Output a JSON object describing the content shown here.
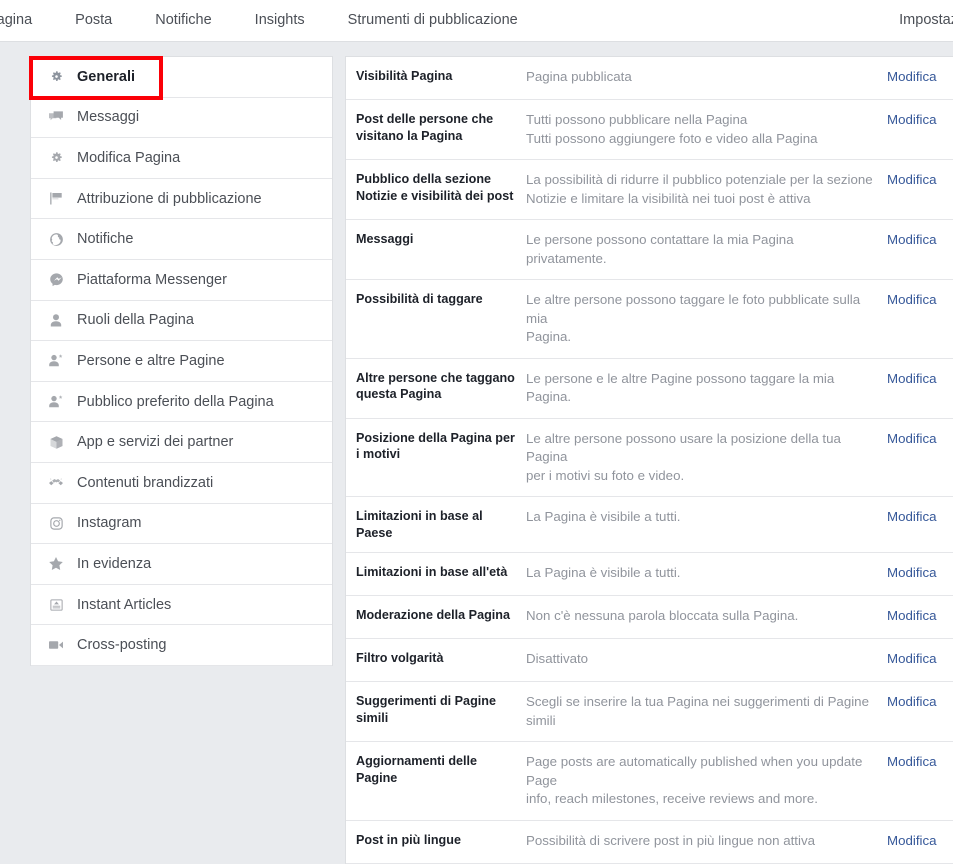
{
  "topnav": {
    "items": [
      {
        "label": "Pagina",
        "name": "nav-pagina"
      },
      {
        "label": "Posta",
        "name": "nav-posta"
      },
      {
        "label": "Notifiche",
        "name": "nav-notifiche"
      },
      {
        "label": "Insights",
        "name": "nav-insights"
      },
      {
        "label": "Strumenti di pubblicazione",
        "name": "nav-strumenti-di-pubblicazione"
      }
    ],
    "right_item": "Impostaz"
  },
  "sidebar": {
    "active_index": 0,
    "items": [
      {
        "label": "Generali",
        "icon": "gear-icon"
      },
      {
        "label": "Messaggi",
        "icon": "chat-bubbles-icon"
      },
      {
        "label": "Modifica Pagina",
        "icon": "gear-icon"
      },
      {
        "label": "Attribuzione di pubblicazione",
        "icon": "flag-icon"
      },
      {
        "label": "Notifiche",
        "icon": "globe-icon"
      },
      {
        "label": "Piattaforma Messenger",
        "icon": "messenger-icon"
      },
      {
        "label": "Ruoli della Pagina",
        "icon": "person-icon"
      },
      {
        "label": "Persone e altre Pagine",
        "icon": "person-star-icon"
      },
      {
        "label": "Pubblico preferito della Pagina",
        "icon": "person-star-icon"
      },
      {
        "label": "App e servizi dei partner",
        "icon": "cube-icon"
      },
      {
        "label": "Contenuti brandizzati",
        "icon": "handshake-icon"
      },
      {
        "label": "Instagram",
        "icon": "instagram-icon"
      },
      {
        "label": "In evidenza",
        "icon": "star-icon"
      },
      {
        "label": "Instant Articles",
        "icon": "article-icon"
      },
      {
        "label": "Cross-posting",
        "icon": "video-camera-icon"
      }
    ]
  },
  "settings_rows": [
    {
      "label": "Visibilità Pagina",
      "values": [
        "Pagina pubblicata"
      ],
      "action": "Modifica"
    },
    {
      "label": "Post delle persone che visitano la Pagina",
      "values": [
        "Tutti possono pubblicare nella Pagina",
        "Tutti possono aggiungere foto e video alla Pagina"
      ],
      "action": "Modifica"
    },
    {
      "label": "Pubblico della sezione Notizie e visibilità dei post",
      "values": [
        "La possibilità di ridurre il pubblico potenziale per la sezione",
        "Notizie e limitare la visibilità nei tuoi post è attiva"
      ],
      "action": "Modifica"
    },
    {
      "label": "Messaggi",
      "values": [
        "Le persone possono contattare la mia Pagina privatamente."
      ],
      "action": "Modifica"
    },
    {
      "label": "Possibilità di taggare",
      "values": [
        "Le altre persone possono taggare le foto pubblicate sulla mia",
        "Pagina."
      ],
      "action": "Modifica"
    },
    {
      "label": "Altre persone che taggano questa Pagina",
      "values": [
        "Le persone e le altre Pagine possono taggare la mia Pagina."
      ],
      "action": "Modifica"
    },
    {
      "label": "Posizione della Pagina per i motivi",
      "values": [
        "Le altre persone possono usare la posizione della tua Pagina",
        "per i motivi su foto e video."
      ],
      "action": "Modifica"
    },
    {
      "label": "Limitazioni in base al Paese",
      "values": [
        "La Pagina è visibile a tutti."
      ],
      "action": "Modifica"
    },
    {
      "label": "Limitazioni in base all'età",
      "values": [
        "La Pagina è visibile a tutti."
      ],
      "action": "Modifica"
    },
    {
      "label": "Moderazione della Pagina",
      "values": [
        "Non c'è nessuna parola bloccata sulla Pagina."
      ],
      "action": "Modifica"
    },
    {
      "label": "Filtro volgarità",
      "values": [
        "Disattivato"
      ],
      "action": "Modifica"
    },
    {
      "label": "Suggerimenti di Pagine simili",
      "values": [
        "Scegli se inserire la tua Pagina nei suggerimenti di Pagine simili"
      ],
      "action": "Modifica"
    },
    {
      "label": "Aggiornamenti delle Pagine",
      "values": [
        "Page posts are automatically published when you update Page",
        "info, reach milestones, receive reviews and more."
      ],
      "action": "Modifica"
    },
    {
      "label": "Post in più lingue",
      "values": [
        "Possibilità di scrivere post in più lingue non attiva"
      ],
      "action": "Modifica"
    }
  ],
  "colors": {
    "link": "#365899",
    "highlight": "#fb0007",
    "page_bg": "#e9ebee",
    "label_text": "#1d2129",
    "value_text": "#90949c"
  }
}
